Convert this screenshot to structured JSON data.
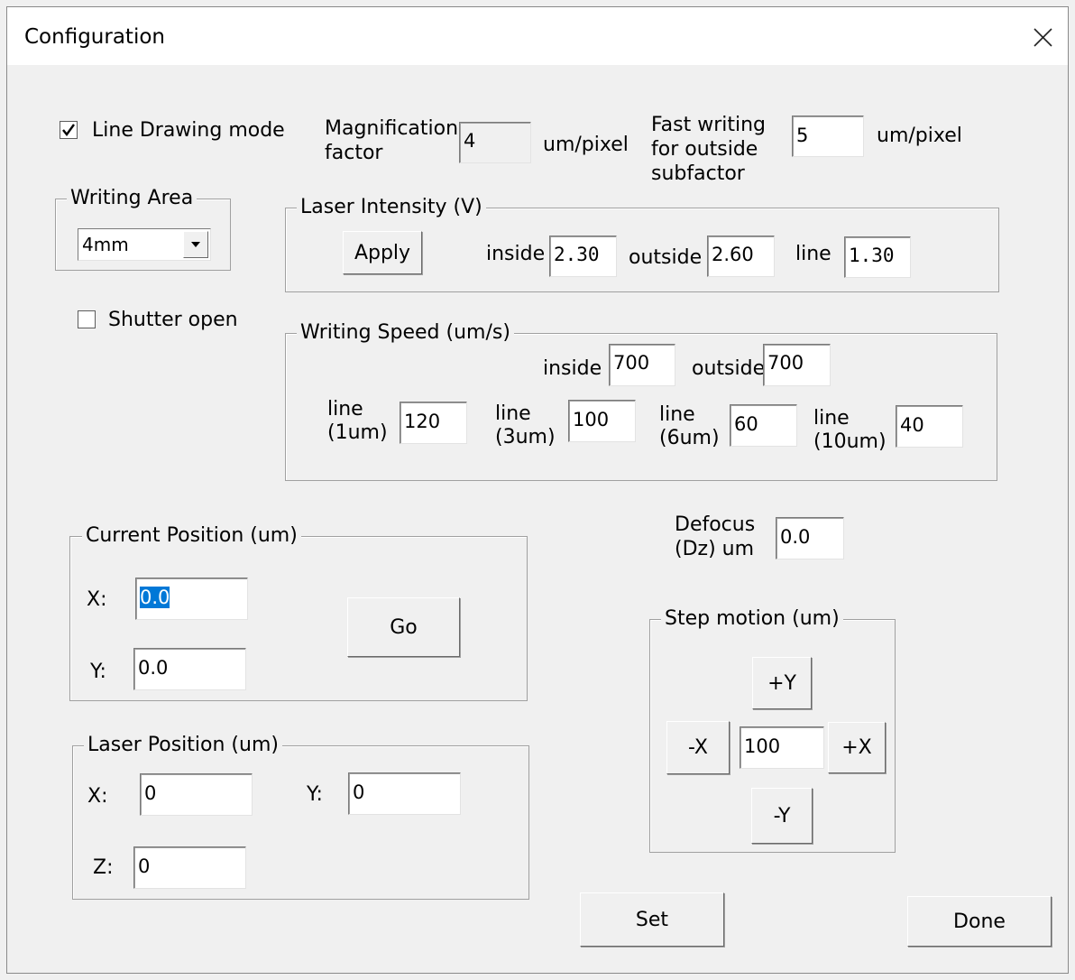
{
  "window": {
    "title": "Configuration",
    "close_icon": "close-icon"
  },
  "line_drawing": {
    "label": "Line Drawing mode",
    "checked": true
  },
  "magnification": {
    "label": "Magnification\nfactor",
    "value": "4",
    "unit": "um/pixel"
  },
  "fast_writing": {
    "label": "Fast writing\nfor outside\nsubfactor",
    "value": "5",
    "unit": "um/pixel"
  },
  "writing_area": {
    "legend": "Writing Area",
    "selected": "4mm"
  },
  "shutter": {
    "label": "Shutter open",
    "checked": false
  },
  "laser_intensity": {
    "legend": "Laser Intensity (V)",
    "apply_label": "Apply",
    "inside_label": "inside",
    "inside_value": "2.30",
    "outside_label": "outside",
    "outside_value": "2.60",
    "line_label": "line",
    "line_value": "1.30"
  },
  "writing_speed": {
    "legend": "Writing Speed (um/s)",
    "inside_label": "inside",
    "inside_value": "700",
    "outside_label": "outside",
    "outside_value": "700",
    "line1_label": "line\n(1um)",
    "line1_value": "120",
    "line3_label": "line\n(3um)",
    "line3_value": "100",
    "line6_label": "line\n(6um)",
    "line6_value": "60",
    "line10_label": "line\n(10um)",
    "line10_value": "40"
  },
  "defocus": {
    "label": "Defocus\n(Dz) um",
    "value": "0.0"
  },
  "current_position": {
    "legend": "Current Position (um)",
    "x_label": "X:",
    "x_value": "0.0",
    "y_label": "Y:",
    "y_value": "0.0",
    "go_label": "Go"
  },
  "laser_position": {
    "legend": "Laser Position (um)",
    "x_label": "X:",
    "x_value": "0",
    "y_label": "Y:",
    "y_value": "0",
    "z_label": "Z:",
    "z_value": "0"
  },
  "step_motion": {
    "legend": "Step motion (um)",
    "plus_y": "+Y",
    "minus_y": "-Y",
    "minus_x": "-X",
    "plus_x": "+X",
    "step_value": "100"
  },
  "buttons": {
    "set": "Set",
    "done": "Done"
  }
}
